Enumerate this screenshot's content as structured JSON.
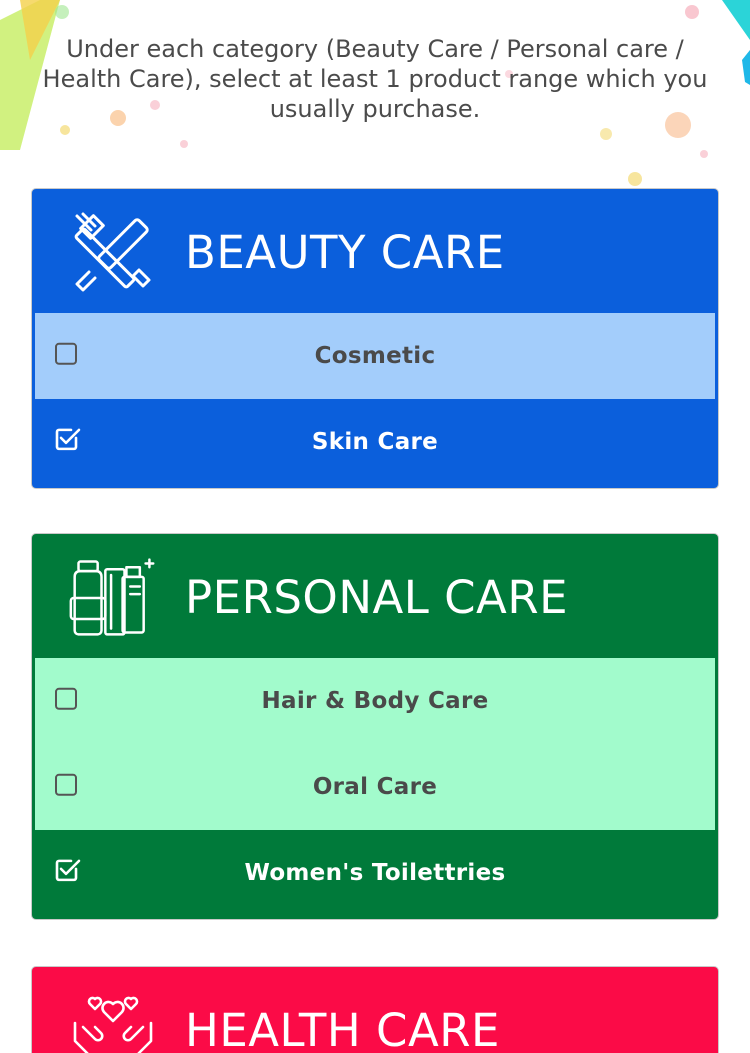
{
  "instructions": "Under each category (Beauty Care / Personal care / Health Care), select at least 1 product range which you usually purchase.",
  "colors": {
    "beauty_primary": "#0b5fdc",
    "beauty_light": "#a3cdfb",
    "personal_primary": "#007a3a",
    "personal_light": "#a2fbcc",
    "health_primary": "#fb0b47"
  },
  "categories": [
    {
      "title": "BEAUTY CARE",
      "icon": "cosmetics-tools-icon",
      "options": [
        {
          "label": "Cosmetic",
          "checked": false
        },
        {
          "label": "Skin Care",
          "checked": true
        }
      ]
    },
    {
      "title": "PERSONAL CARE",
      "icon": "toiletries-bottles-icon",
      "options": [
        {
          "label": "Hair & Body Care",
          "checked": false
        },
        {
          "label": "Oral Care",
          "checked": false
        },
        {
          "label": "Women's Toilettries",
          "checked": true
        }
      ]
    },
    {
      "title": "HEALTH CARE",
      "icon": "hands-hearts-icon",
      "options": []
    }
  ]
}
